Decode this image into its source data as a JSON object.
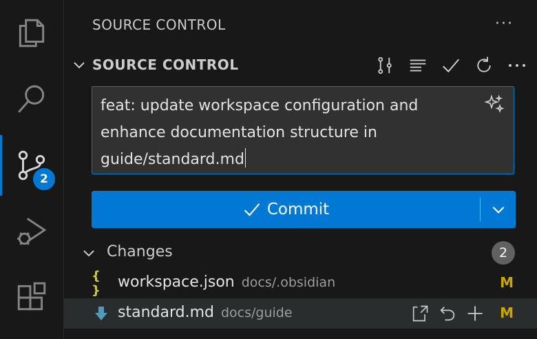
{
  "activity_bar": {
    "items": [
      {
        "name": "explorer",
        "icon": "files-icon"
      },
      {
        "name": "search",
        "icon": "search-icon"
      },
      {
        "name": "source-control",
        "icon": "source-control-icon",
        "active": true,
        "badge": "2"
      },
      {
        "name": "run-debug",
        "icon": "run-debug-icon"
      },
      {
        "name": "extensions",
        "icon": "extensions-icon"
      }
    ]
  },
  "pane": {
    "title": "SOURCE CONTROL",
    "more": "···"
  },
  "section": {
    "title": "SOURCE CONTROL",
    "actions": [
      "graph-icon",
      "view-as-list-icon",
      "check-icon",
      "refresh-icon",
      "more-icon"
    ]
  },
  "commit": {
    "message_line1": "feat: update workspace configuration and",
    "message_line2": "enhance documentation structure in",
    "message_line3": "guide/standard.md",
    "button_label": "Commit"
  },
  "changes": {
    "title": "Changes",
    "count": "2",
    "files": [
      {
        "name": "workspace.json",
        "path": "docs/.obsidian",
        "status": "M",
        "icon": "{ }",
        "icon_color": "#cbcb41"
      },
      {
        "name": "standard.md",
        "path": "docs/guide",
        "status": "M",
        "icon": "download-arrow-icon",
        "icon_color": "#519aba"
      }
    ]
  },
  "colors": {
    "accent": "#0078d4",
    "modified": "#cca700"
  }
}
